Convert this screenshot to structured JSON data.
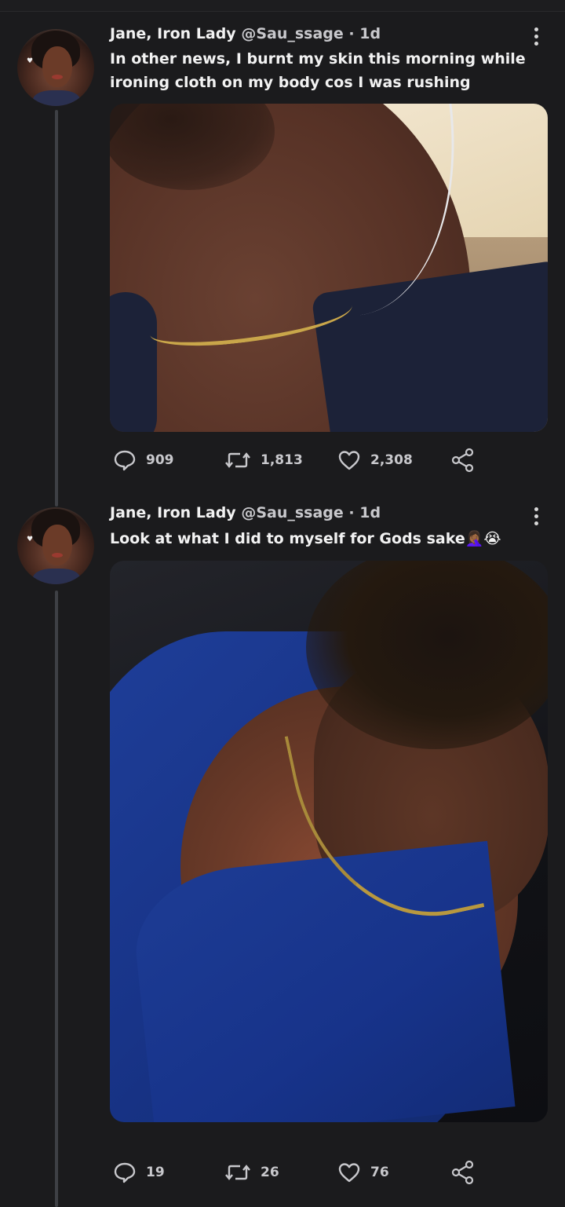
{
  "tweets": [
    {
      "author_name": "Jane, Iron Lady",
      "handle": "@Sau_ssage",
      "time": "· 1d",
      "text": "In other news, I burnt my skin this morning while ironing cloth on my body cos I was rushing",
      "replies": "909",
      "retweets": "1,813",
      "likes": "2,308"
    },
    {
      "author_name": "Jane, Iron Lady",
      "handle": "@Sau_ssage",
      "time": "· 1d",
      "text": "Look at what I did to myself for Gods sake🤦🏾‍♀️😭",
      "replies": "19",
      "retweets": "26",
      "likes": "76"
    }
  ],
  "icons": {
    "reply": "reply-icon",
    "retweet": "retweet-icon",
    "like": "heart-icon",
    "share": "share-icon",
    "more": "more-options-icon"
  },
  "colors": {
    "background": "#1b1b1d",
    "text": "#f2f2f2",
    "secondary_text": "#c8c8cc",
    "thread_line": "#3e4045"
  }
}
